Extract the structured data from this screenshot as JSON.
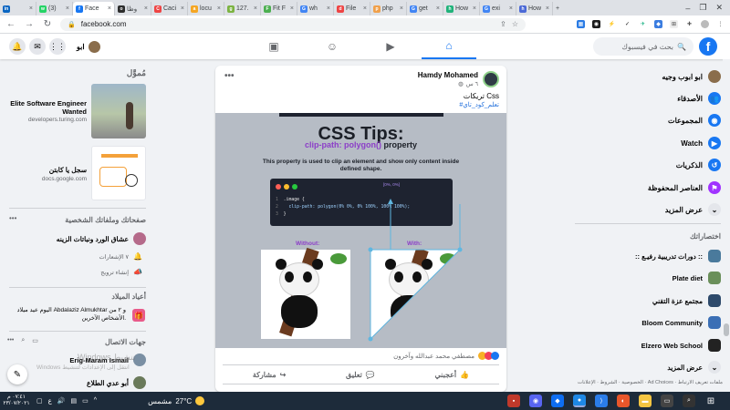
{
  "browser": {
    "tabs": [
      {
        "label": "",
        "favicon": "in",
        "color": "#0a66c2"
      },
      {
        "label": "(3)",
        "favicon": "w",
        "color": "#25d366"
      },
      {
        "label": "Face",
        "favicon": "f",
        "color": "#1877f2",
        "active": true
      },
      {
        "label": "وظا",
        "favicon": "o",
        "color": "#2d2d2d"
      },
      {
        "label": "Caci",
        "favicon": "C",
        "color": "#e44"
      },
      {
        "label": "locu",
        "favicon": "a",
        "color": "#f5a623"
      },
      {
        "label": "127.",
        "favicon": "g",
        "color": "#7cb342"
      },
      {
        "label": "Fit F",
        "favicon": "F",
        "color": "#4caf50"
      },
      {
        "label": "wh",
        "favicon": "G",
        "color": "#4285f4"
      },
      {
        "label": "File",
        "favicon": "d",
        "color": "#e44"
      },
      {
        "label": "php",
        "favicon": "p",
        "color": "#f0a04b"
      },
      {
        "label": "get",
        "favicon": "G",
        "color": "#4285f4"
      },
      {
        "label": "How",
        "favicon": "h",
        "color": "#20b27a"
      },
      {
        "label": "exi",
        "favicon": "G",
        "color": "#4285f4"
      },
      {
        "label": "How",
        "favicon": "h",
        "color": "#4b69d6"
      }
    ],
    "url": "facebook.com"
  },
  "fbnav": {
    "search_placeholder": "بحث في فيسبوك",
    "profile_name": "ابو"
  },
  "right_sidebar": {
    "items": [
      {
        "label": "ابو ابوب وجيه",
        "icon": "avatar-icon",
        "color": "#8a6d4b"
      },
      {
        "label": "الأصدقاء",
        "icon": "friends-icon",
        "color": "#1877f2"
      },
      {
        "label": "المجموعات",
        "icon": "groups-icon",
        "color": "#1877f2"
      },
      {
        "label": "Watch",
        "icon": "watch-icon",
        "color": "#1877f2"
      },
      {
        "label": "الذكريات",
        "icon": "memories-icon",
        "color": "#1877f2"
      },
      {
        "label": "العناصر المحفوظة",
        "icon": "saved-icon",
        "color": "#a033ff"
      },
      {
        "label": "عرض المزيد",
        "icon": "chevron-down-icon",
        "color": "#e4e6eb"
      }
    ],
    "shortcuts_title": "اختصاراتك",
    "shortcuts": [
      {
        "label": ":: دورات تدريبية رفيـع ::",
        "color": "#4a7a9c"
      },
      {
        "label": "Plate diet",
        "color": "#6a8f5a"
      },
      {
        "label": "مجتمع عزة التقني",
        "color": "#2e4a6b"
      },
      {
        "label": "Bloom Community",
        "color": "#3b6fb5"
      },
      {
        "label": "Elzero Web School",
        "color": "#222"
      },
      {
        "label": "عرض المزيد",
        "color": "#e4e6eb"
      }
    ],
    "footer": "الخصوصية · الشروط · الإعلانات · Ad Choices · ملفات تعريف الارتباط"
  },
  "left_sidebar": {
    "sponsored_title": "مُموَّل",
    "ads": [
      {
        "title": "Elite Software Engineer Wanted",
        "domain": "developers.turing.com"
      },
      {
        "title": "سجل يا كابتن",
        "domain": "docs.google.com"
      }
    ],
    "pages_title": "صفحاتك وملفاتك الشخصية",
    "page_name": "عشاق الورد ونباتات الزينه",
    "notifications": "٧ الإشعارات",
    "create_promotion": "إنشاء ترويج",
    "birthdays_title": "أعياد الميلاد",
    "birthday_text": "اليوم عيد ميلاد Abdalaziz Almukhtar و ٢ من الأشخاص الآخرين.",
    "contacts_title": "جهات الاتصال",
    "contacts": [
      "Erig-Maram Ismail",
      "أبو عدي الطلاع"
    ],
    "watermark": "Windows تنشيط",
    "watermark_sub": "Windows انتقل إلى الإعدادات لتنشيط"
  },
  "post": {
    "author": "Hamdy Mohamed",
    "time": "٦ س",
    "text": "تريكات Css",
    "hashtag": "#تعلم_كود_تاي",
    "image": {
      "heading": "CSS Tips:",
      "subheading_code": "clip-path: polygon()",
      "subheading_rest": " property",
      "description": "This property is used to clip an element and show only content inside defined shape.",
      "code_lines": [
        {
          "num": "1",
          "text": ".image {"
        },
        {
          "num": "2",
          "text": "clip-path: polygon(0% 0%, 0% 100%, 100% 100%);"
        },
        {
          "num": "3",
          "text": "}"
        }
      ],
      "point_label": "[0%, 0%]",
      "without_label": "Without:",
      "with_label": "With:"
    },
    "reactions_text": "مصطفي محمد عبدالله وآخرون",
    "actions": {
      "like": "أعجبني",
      "comment": "تعليق",
      "share": "مشاركة"
    }
  },
  "taskbar": {
    "weather": "27°C",
    "weather_label": "مشمس",
    "time": "٠٧:٤١ م",
    "date": "٢٣/٠٧/٢٠٢١"
  }
}
